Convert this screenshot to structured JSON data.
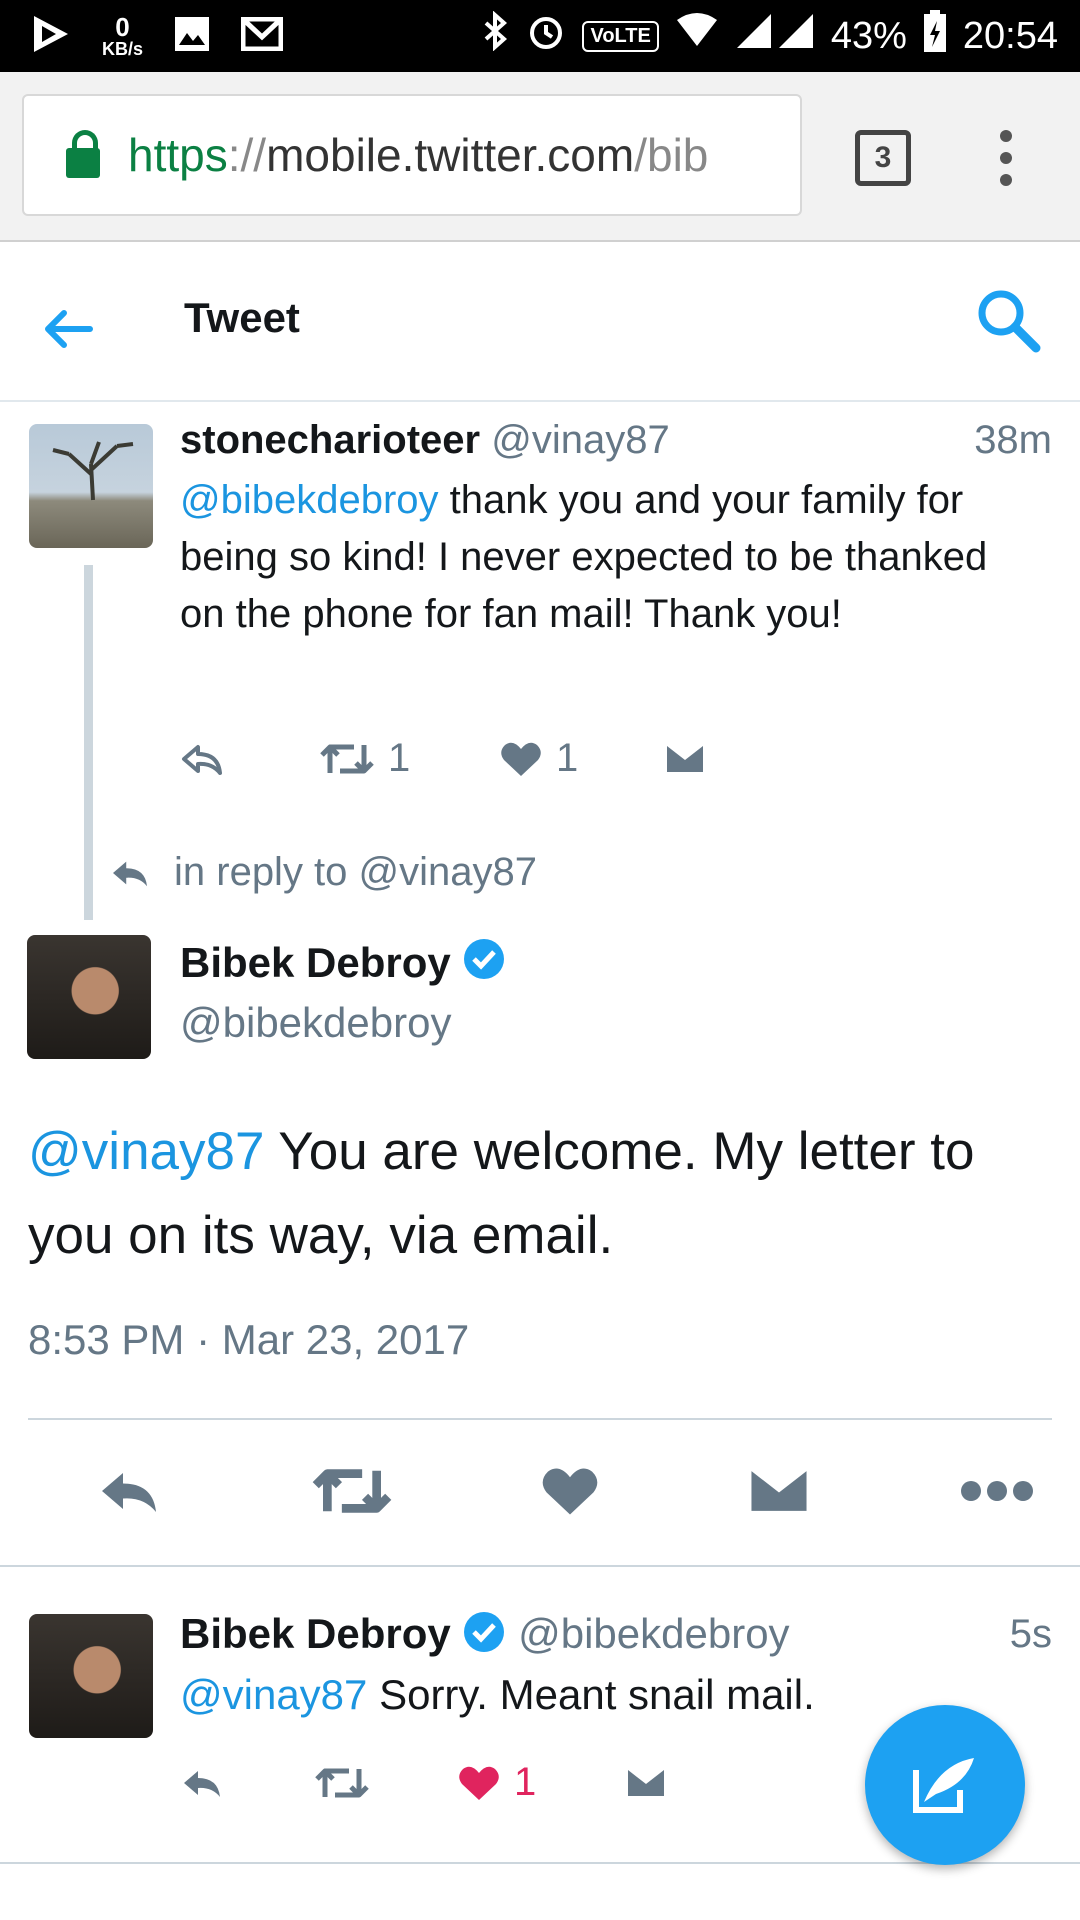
{
  "status_bar": {
    "net_speed": "0",
    "net_unit": "KB/s",
    "volte": "VoLTE",
    "battery": "43%",
    "time": "20:54"
  },
  "browser": {
    "url_scheme": "https",
    "url_sep": "://",
    "url_host": "mobile.twitter.com",
    "url_path": "/bib",
    "tab_count": "3"
  },
  "header": {
    "title": "Tweet"
  },
  "parent_tweet": {
    "name": "stonecharioteer",
    "handle": "@vinay87",
    "time": "38m",
    "mention": "@bibekdebroy",
    "text": " thank you and your family for being so kind! I never expected to be thanked on the phone for fan mail! Thank you!",
    "retweets": "1",
    "likes": "1"
  },
  "reply_context": {
    "text": "in reply to @vinay87"
  },
  "main_tweet": {
    "name": "Bibek Debroy",
    "handle": "@bibekdebroy",
    "mention": "@vinay87",
    "text": " You are welcome. My letter to you on its way, via email.",
    "timestamp": "8:53 PM · Mar 23, 2017"
  },
  "reply_tweet": {
    "name": "Bibek Debroy",
    "handle": "@bibekdebroy",
    "time": "5s",
    "mention": "@vinay87",
    "text": " Sorry. Meant snail mail.",
    "likes": "1"
  },
  "colors": {
    "accent": "#1da1f2",
    "link": "#1b95e0",
    "like": "#e0245e",
    "secure": "#0b8043"
  }
}
